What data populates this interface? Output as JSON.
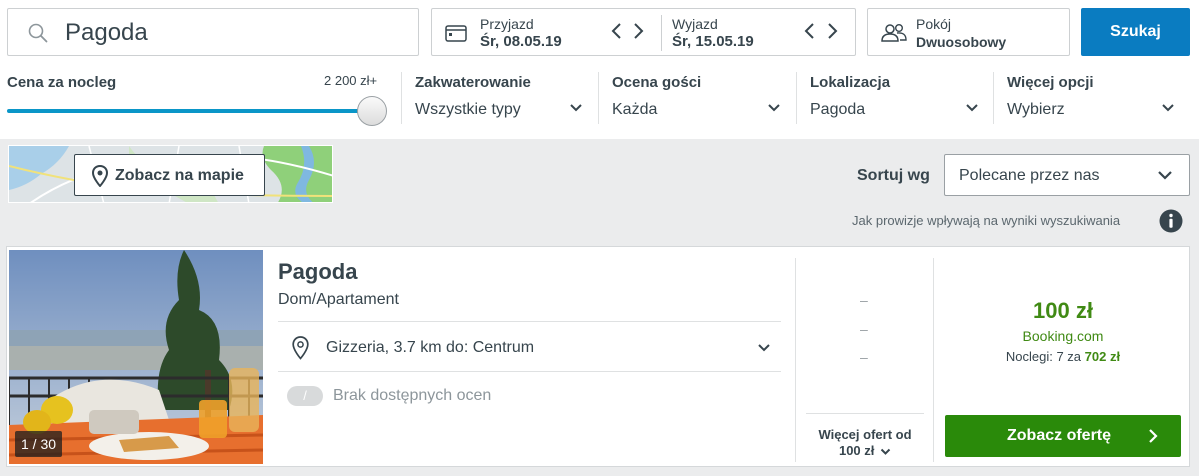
{
  "search": {
    "query": "Pagoda"
  },
  "dates": {
    "checkin_label": "Przyjazd",
    "checkin_value": "Śr, 08.05.19",
    "checkout_label": "Wyjazd",
    "checkout_value": "Śr, 15.05.19"
  },
  "rooms": {
    "label": "Pokój",
    "value": "Dwuosobowy"
  },
  "search_button": "Szukaj",
  "filters": {
    "price": {
      "label": "Cena za nocleg",
      "max": "2 200 zł+",
      "level": 1.0
    },
    "accommodation": {
      "label": "Zakwaterowanie",
      "value": "Wszystkie typy"
    },
    "rating": {
      "label": "Ocena gości",
      "value": "Każda"
    },
    "location": {
      "label": "Lokalizacja",
      "value": "Pagoda"
    },
    "more": {
      "label": "Więcej opcji",
      "value": "Wybierz"
    }
  },
  "map_button": "Zobacz na mapie",
  "sort": {
    "label": "Sortuj wg",
    "value": "Polecane przez nas"
  },
  "disclaimer": "Jak prowizje wpływają na wyniki wyszukiwania",
  "hotel": {
    "photo_count": "1 / 30",
    "name": "Pagoda",
    "type": "Dom/Apartament",
    "location": "Gizzeria, 3.7 km do: Centrum",
    "rating_badge": "/",
    "rating_text": "Brak dostępnych ocen",
    "dashes": [
      "–",
      "–",
      "–"
    ],
    "more_offers_line1": "Więcej ofert od",
    "more_offers_line2": "100 zł",
    "price": "100 zł",
    "site": "Booking.com",
    "nights_prefix": "Noclegi: 7 za",
    "nights_total": "702 zł",
    "offer_button": "Zobacz ofertę"
  },
  "colors": {
    "primary": "#0a7cc1",
    "deal_green": "#408a14",
    "cta_green": "#2a8a0a",
    "slider": "#0a96c8"
  }
}
